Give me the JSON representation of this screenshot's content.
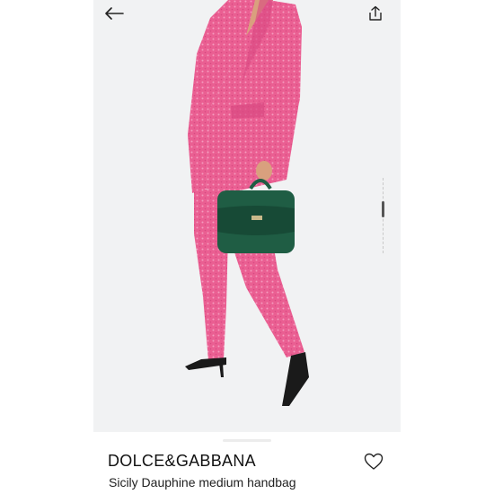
{
  "product": {
    "brand": "DOLCE&GABBANA",
    "name": "Sicily Dauphine medium handbag"
  },
  "icons": {
    "back": "arrow-left-icon",
    "share": "share-icon",
    "favorite": "heart-outline-icon"
  },
  "colors": {
    "suit": "#ea5f92",
    "bag": "#1f5d44",
    "photo_background": "#f1f2f3"
  },
  "gallery": {
    "image_description": "Model wearing pink tweed suit holding green Sicily handbag"
  }
}
